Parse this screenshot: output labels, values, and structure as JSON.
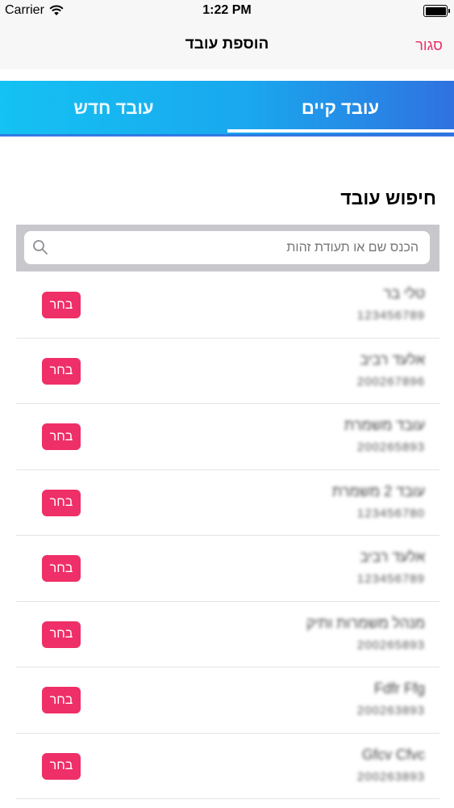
{
  "status_bar": {
    "carrier": "Carrier",
    "time": "1:22 PM"
  },
  "nav": {
    "title": "הוספת עובד",
    "close_label": "סגור"
  },
  "tabs": {
    "existing_label": "עובד קיים",
    "new_label": "עובד חדש",
    "active": "existing"
  },
  "search": {
    "title": "חיפוש עובד",
    "placeholder": "הכנס שם או תעודת זהות",
    "value": ""
  },
  "employees": [
    {
      "name": "טלי בר",
      "id": "123456789",
      "choose_label": "בחר"
    },
    {
      "name": "אלעד רביב",
      "id": "200267896",
      "choose_label": "בחר"
    },
    {
      "name": "עובד משמרת",
      "id": "200265893",
      "choose_label": "בחר"
    },
    {
      "name": "עובד 2 משמרת",
      "id": "123456780",
      "choose_label": "בחר"
    },
    {
      "name": "אלעד רביב",
      "id": "123456789",
      "choose_label": "בחר"
    },
    {
      "name": "מנהל משמרות ותיק",
      "id": "200265893",
      "choose_label": "בחר"
    },
    {
      "name": "Fdfr Ffg",
      "id": "200263893",
      "choose_label": "בחר"
    },
    {
      "name": "Gfcv Cfvc",
      "id": "200263893",
      "choose_label": "בחר"
    }
  ],
  "colors": {
    "accent": "#ef2f67",
    "close": "#e8336b",
    "tab_gradient_start": "#14c2f3",
    "tab_gradient_end": "#2f72e0"
  }
}
